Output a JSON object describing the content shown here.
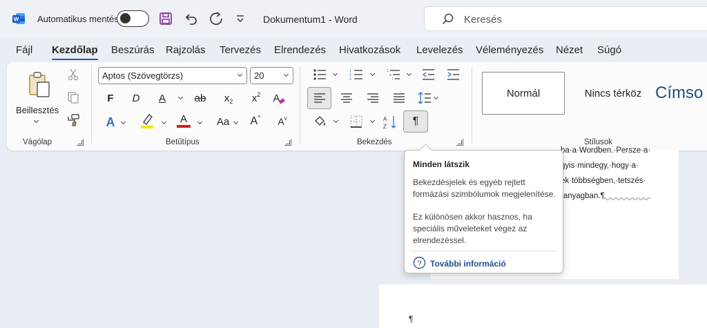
{
  "app": {
    "autosave_label": "Automatikus mentés",
    "document_title": "Dokumentum1  -  Word",
    "search_placeholder": "Keresés"
  },
  "menu": [
    "Fájl",
    "Kezdőlap",
    "Beszúrás",
    "Rajzolás",
    "Tervezés",
    "Elrendezés",
    "Hivatkozások",
    "Levelezés",
    "Véleményezés",
    "Nézet",
    "Súgó"
  ],
  "menu_active": "Kezdőlap",
  "ribbon": {
    "clipboard": {
      "paste_label": "Beillesztés",
      "group_label": "Vágólap"
    },
    "font": {
      "font_name": "Aptos (Szövegtörzs)",
      "font_size": "20",
      "bold": "F",
      "italic": "D",
      "underline": "A",
      "strikethrough": "ab",
      "subscript_base": "x",
      "subscript_mark": "2",
      "superscript_base": "x",
      "superscript_mark": "2",
      "clear_format": "A",
      "text_effects": "A",
      "font_color": "A",
      "change_case": "Aa",
      "grow_font": "A",
      "shrink_font": "A",
      "group_label": "Betűtípus"
    },
    "paragraph": {
      "group_label": "Bekezdés",
      "show_marks": "¶"
    },
    "styles": {
      "items": [
        "Normál",
        "Nincs térköz",
        "Címso"
      ],
      "group_label": "Stílusok"
    }
  },
  "document": {
    "lines": [
      "ba·a·Wordben.·Persze·a·",
      "gyis·mindegy,·hogy·a·",
      "ek·többségben,·tetszés·",
      "·anyagban.¶"
    ],
    "page2_mark": "¶"
  },
  "tooltip": {
    "title": "Minden látszik",
    "paragraph1": "Bekezdésjelek és egyéb rejtett formázási szimbólumok megjelenítése.",
    "paragraph2": "Ez különösen akkor hasznos, ha speciális műveleteket végez az elrendezéssel.",
    "link": "További információ"
  },
  "colors": {
    "brand": "#2b579a",
    "accent_purple": "#8b3a9a",
    "highlight": "#f2e600",
    "font_color": "#d11f1f",
    "link": "#1f4e8c"
  },
  "icons": [
    "word-logo-icon",
    "save-icon",
    "undo-icon",
    "redo-icon",
    "customize-quick-access-icon",
    "search-icon",
    "paste-icon",
    "cut-icon",
    "copy-icon",
    "format-painter-icon",
    "bullets-icon",
    "numbering-icon",
    "multilevel-list-icon",
    "decrease-indent-icon",
    "increase-indent-icon",
    "align-left-icon",
    "align-center-icon",
    "align-right-icon",
    "justify-icon",
    "line-spacing-icon",
    "shading-icon",
    "borders-icon",
    "sort-icon",
    "highlight-icon",
    "help-icon"
  ]
}
